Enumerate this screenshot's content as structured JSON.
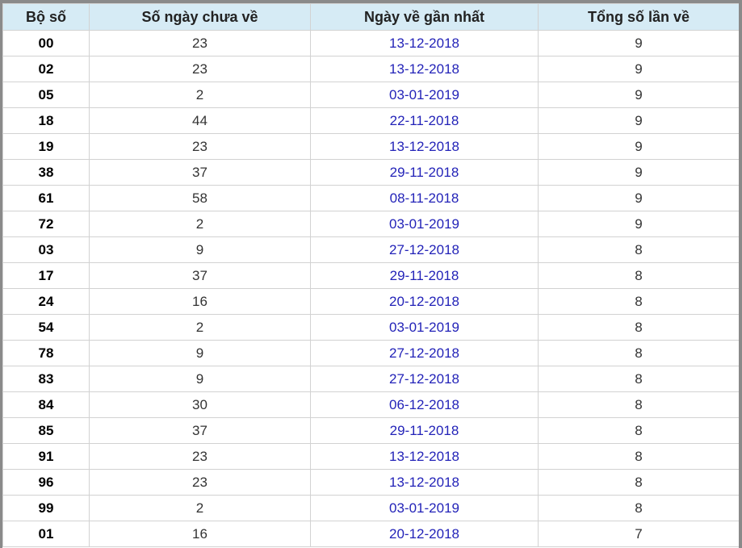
{
  "table": {
    "headers": [
      "Bộ số",
      "Số ngày chưa về",
      "Ngày về gần nhất",
      "Tổng số lần về"
    ],
    "rows": [
      {
        "bo_so": "00",
        "so_ngay": "23",
        "ngay_ve": "13-12-2018",
        "tong": "9"
      },
      {
        "bo_so": "02",
        "so_ngay": "23",
        "ngay_ve": "13-12-2018",
        "tong": "9"
      },
      {
        "bo_so": "05",
        "so_ngay": "2",
        "ngay_ve": "03-01-2019",
        "tong": "9"
      },
      {
        "bo_so": "18",
        "so_ngay": "44",
        "ngay_ve": "22-11-2018",
        "tong": "9"
      },
      {
        "bo_so": "19",
        "so_ngay": "23",
        "ngay_ve": "13-12-2018",
        "tong": "9"
      },
      {
        "bo_so": "38",
        "so_ngay": "37",
        "ngay_ve": "29-11-2018",
        "tong": "9"
      },
      {
        "bo_so": "61",
        "so_ngay": "58",
        "ngay_ve": "08-11-2018",
        "tong": "9"
      },
      {
        "bo_so": "72",
        "so_ngay": "2",
        "ngay_ve": "03-01-2019",
        "tong": "9"
      },
      {
        "bo_so": "03",
        "so_ngay": "9",
        "ngay_ve": "27-12-2018",
        "tong": "8"
      },
      {
        "bo_so": "17",
        "so_ngay": "37",
        "ngay_ve": "29-11-2018",
        "tong": "8"
      },
      {
        "bo_so": "24",
        "so_ngay": "16",
        "ngay_ve": "20-12-2018",
        "tong": "8"
      },
      {
        "bo_so": "54",
        "so_ngay": "2",
        "ngay_ve": "03-01-2019",
        "tong": "8"
      },
      {
        "bo_so": "78",
        "so_ngay": "9",
        "ngay_ve": "27-12-2018",
        "tong": "8"
      },
      {
        "bo_so": "83",
        "so_ngay": "9",
        "ngay_ve": "27-12-2018",
        "tong": "8"
      },
      {
        "bo_so": "84",
        "so_ngay": "30",
        "ngay_ve": "06-12-2018",
        "tong": "8"
      },
      {
        "bo_so": "85",
        "so_ngay": "37",
        "ngay_ve": "29-11-2018",
        "tong": "8"
      },
      {
        "bo_so": "91",
        "so_ngay": "23",
        "ngay_ve": "13-12-2018",
        "tong": "8"
      },
      {
        "bo_so": "96",
        "so_ngay": "23",
        "ngay_ve": "13-12-2018",
        "tong": "8"
      },
      {
        "bo_so": "99",
        "so_ngay": "2",
        "ngay_ve": "03-01-2019",
        "tong": "8"
      },
      {
        "bo_so": "01",
        "so_ngay": "16",
        "ngay_ve": "20-12-2018",
        "tong": "7"
      }
    ]
  },
  "colors": {
    "header_bg": "#d6ebf5",
    "date_text": "#2323b8",
    "border": "#d2d2d2",
    "frame": "#8a8a8a"
  }
}
